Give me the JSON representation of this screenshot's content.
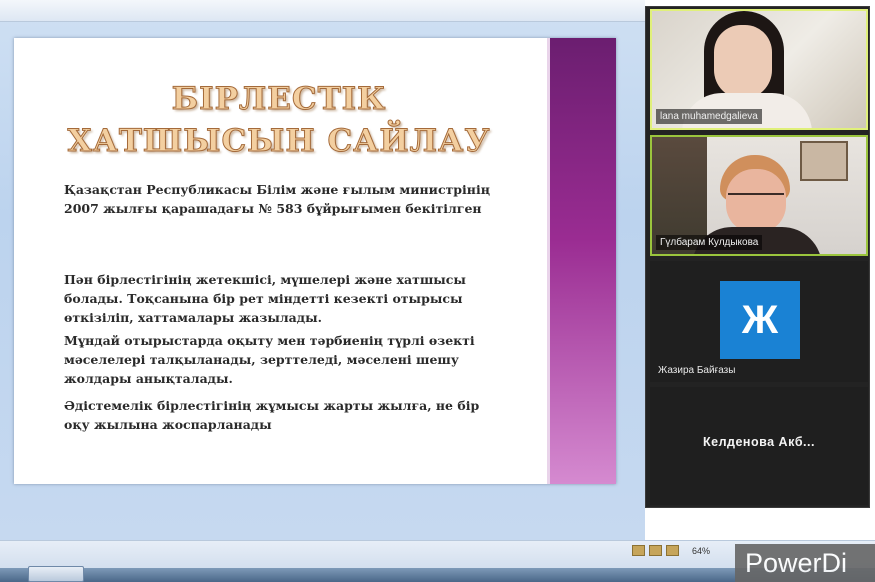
{
  "slide": {
    "title_line1": "БІРЛЕСТІК",
    "title_line2": "ХАТШЫСЫН САЙЛАУ",
    "para1": "Қазақстан Республикасы Білім және ғылым министрінің 2007 жылғы қарашадағы № 583 бұйрығымен бекітілген",
    "para2": "Пән бірлестігінің жетекшісі, мүшелері және хатшысы болады. Тоқсанына бір рет міндетті кезекті отырысы өткізіліп, хаттамалары жазылады.",
    "para3": "Мұндай отырыстарда оқыту мен тәрбиенің түрлі өзекті мәселелері талқыланады, зерттеледі, мәселені шешу жолдары анықталады.",
    "para4": "Әдістемелік бірлестігінің жұмысы жарты жылға, не бір оқу жылына жоспарланады"
  },
  "participants": [
    {
      "name": "lana muhamedgalieva",
      "video": true
    },
    {
      "name": "Гүлбарам Кулдыкова",
      "video": true
    },
    {
      "name": "Жазира Байғазы",
      "avatar_letter": "Ж",
      "avatar_color": "#1a82d4",
      "video": false
    },
    {
      "name": "Келденова Акб...",
      "video": false
    }
  ],
  "status": {
    "zoom": "64%"
  },
  "watermark": "PowerDi"
}
